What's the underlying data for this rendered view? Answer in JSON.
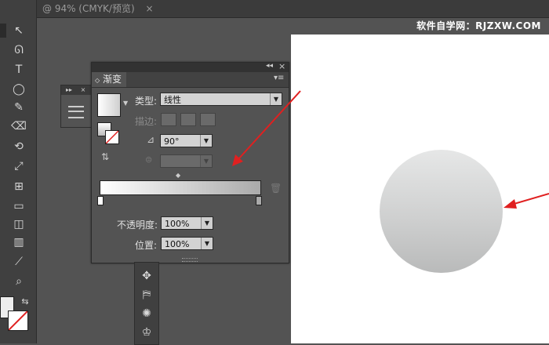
{
  "document": {
    "tab_title": "@ 94% (CMYK/预览)",
    "watermark": "软件自学网：RJZXW.COM"
  },
  "gradient_panel": {
    "title": "渐变",
    "type_label": "类型:",
    "type_value": "线性",
    "stroke_label": "描边:",
    "angle_value": "90°",
    "opacity_label": "不透明度:",
    "opacity_value": "100%",
    "location_label": "位置:",
    "location_value": "100%"
  },
  "colors": {
    "accent_arrow": "#e02020",
    "gradient_start": "#ffffff",
    "gradient_end": "#aaaaaa"
  },
  "icons": [
    "arrow-icon",
    "lasso-icon",
    "type-icon",
    "ellipse-icon",
    "pen-icon",
    "eraser-icon",
    "rotate-icon",
    "scale-icon",
    "graph-icon",
    "gradient-icon",
    "zoom-icon",
    "trash-icon",
    "swap-icon",
    "menu-icon"
  ]
}
